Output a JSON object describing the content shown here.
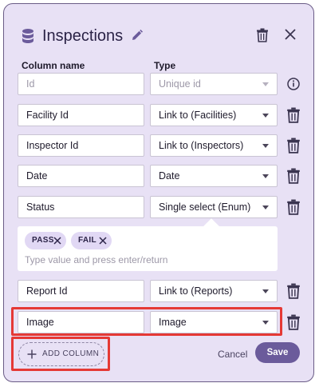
{
  "dialog": {
    "title": "Inspections",
    "icons": [
      "database-icon",
      "pencil-icon",
      "trash-icon",
      "close-icon"
    ]
  },
  "columns_header": {
    "name": "Column name",
    "type": "Type"
  },
  "rows": [
    {
      "name": "",
      "name_placeholder": "Id",
      "type": "Unique id",
      "type_disabled": true,
      "action": "info-icon"
    },
    {
      "name": "Facility Id",
      "type": "Link to (Facilities)",
      "action": "trash-icon"
    },
    {
      "name": "Inspector Id",
      "type": "Link to (Inspectors)",
      "action": "trash-icon"
    },
    {
      "name": "Date",
      "type": "Date",
      "action": "trash-icon"
    },
    {
      "name": "Status",
      "type": "Single select (Enum)",
      "action": "trash-icon"
    },
    {
      "name": "Report Id",
      "type": "Link to (Reports)",
      "action": "trash-icon"
    },
    {
      "name": "Image",
      "type": "Image",
      "action": "trash-icon"
    }
  ],
  "enum": {
    "options": [
      "PASS",
      "FAIL"
    ],
    "placeholder": "Type value and press enter/return"
  },
  "footer": {
    "add_column": "ADD COLUMN",
    "cancel": "Cancel",
    "save": "Save"
  },
  "colors": {
    "accent": "#6b5b9b",
    "background": "#e8e1f5",
    "highlight": "#e53935"
  }
}
